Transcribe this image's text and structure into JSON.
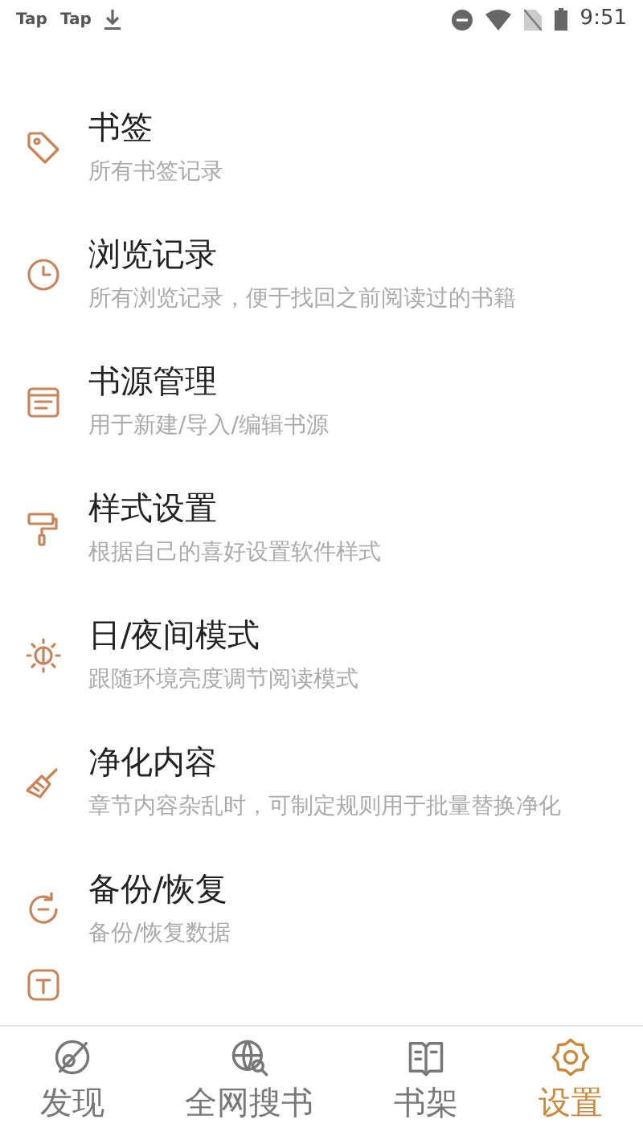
{
  "status_bar": {
    "notifications": [
      "Tap",
      "Tap"
    ],
    "time": "9:51"
  },
  "menu": [
    {
      "title": "书签",
      "subtitle": "所有书签记录"
    },
    {
      "title": "浏览记录",
      "subtitle": "所有浏览记录，便于找回之前阅读过的书籍"
    },
    {
      "title": "书源管理",
      "subtitle": "用于新建/导入/编辑书源"
    },
    {
      "title": "样式设置",
      "subtitle": "根据自己的喜好设置软件样式"
    },
    {
      "title": "日/夜间模式",
      "subtitle": "跟随环境亮度调节阅读模式"
    },
    {
      "title": "净化内容",
      "subtitle": "章节内容杂乱时，可制定规则用于批量替换净化"
    },
    {
      "title": "备份/恢复",
      "subtitle": "备份/恢复数据"
    }
  ],
  "tabs": [
    {
      "label": "发现",
      "selected": false
    },
    {
      "label": "全网搜书",
      "selected": false
    },
    {
      "label": "书架",
      "selected": false
    },
    {
      "label": "设置",
      "selected": true
    }
  ]
}
